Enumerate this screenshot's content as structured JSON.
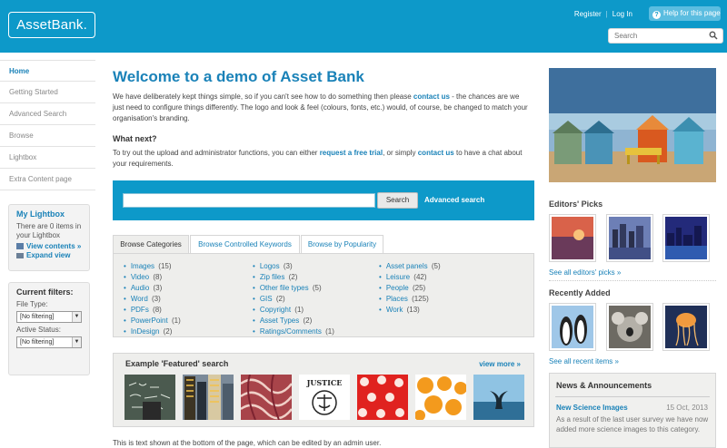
{
  "header": {
    "logo": "AssetBank.",
    "register": "Register",
    "login": "Log In",
    "help": "Help for this page",
    "search_placeholder": "Search"
  },
  "nav": {
    "items": [
      {
        "label": "Home",
        "active": true
      },
      {
        "label": "Getting Started"
      },
      {
        "label": "Advanced Search"
      },
      {
        "label": "Browse"
      },
      {
        "label": "Lightbox"
      },
      {
        "label": "Extra Content page"
      }
    ]
  },
  "lightbox": {
    "title": "My Lightbox",
    "text": "There are 0 items in your Lightbox",
    "view": "View contents »",
    "expand": "Expand view"
  },
  "filters": {
    "title": "Current filters:",
    "file_type_label": "File Type:",
    "file_type_value": "[No filtering]",
    "status_label": "Active Status:",
    "status_value": "[No filtering]"
  },
  "main": {
    "title": "Welcome to a demo of Asset Bank",
    "intro_1": "We have deliberately kept things simple, so if you can't see how to do something then please ",
    "intro_link": "contact us",
    "intro_2": " - the chances are we just need to configure things differently. The logo and look & feel (colours, fonts, etc.) would, of course, be changed to match your organisation's branding.",
    "whatnext": "What next?",
    "trial_1": "To try out the upload and administrator functions, you can either ",
    "trial_link1": "request a free trial",
    "trial_2": ", or simply ",
    "trial_link2": "contact us",
    "trial_3": " to have a chat about your requirements.",
    "search_button": "Search",
    "advanced": "Advanced search",
    "tabs": [
      "Browse Categories",
      "Browse Controlled Keywords",
      "Browse by Popularity"
    ],
    "categories": [
      [
        {
          "name": "Images",
          "count": "(15)"
        },
        {
          "name": "Video",
          "count": "(8)"
        },
        {
          "name": "Audio",
          "count": "(3)"
        },
        {
          "name": "Word",
          "count": "(3)"
        },
        {
          "name": "PDFs",
          "count": "(8)"
        },
        {
          "name": "PowerPoint",
          "count": "(1)"
        },
        {
          "name": "InDesign",
          "count": "(2)"
        }
      ],
      [
        {
          "name": "Logos",
          "count": "(3)"
        },
        {
          "name": "Zip files",
          "count": "(2)"
        },
        {
          "name": "Other file types",
          "count": "(5)"
        },
        {
          "name": "GIS",
          "count": "(2)"
        },
        {
          "name": "Copyright",
          "count": "(1)"
        },
        {
          "name": "Asset Types",
          "count": "(2)"
        },
        {
          "name": "Ratings/Comments",
          "count": "(1)"
        }
      ],
      [
        {
          "name": "Asset panels",
          "count": "(5)"
        },
        {
          "name": "Leisure",
          "count": "(42)"
        },
        {
          "name": "People",
          "count": "(25)"
        },
        {
          "name": "Places",
          "count": "(125)"
        },
        {
          "name": "Work",
          "count": "(13)"
        }
      ]
    ],
    "featured_title": "Example 'Featured' search",
    "featured_more": "view more »",
    "bottom_text": "This is text shown at the bottom of the page, which can be edited by an admin user."
  },
  "right": {
    "editors_title": "Editors' Picks",
    "editors_link": "See all editors' picks »",
    "recent_title": "Recently Added",
    "recent_link": "See all recent items »",
    "news_title": "News & Announcements",
    "news_item_title": "New Science Images",
    "news_item_date": "15 Oct, 2013",
    "news_item_text": "As a result of the last user survey we have now added more science images to this category."
  },
  "colors": {
    "brand": "#0d99c9",
    "link": "#1a82b8"
  }
}
